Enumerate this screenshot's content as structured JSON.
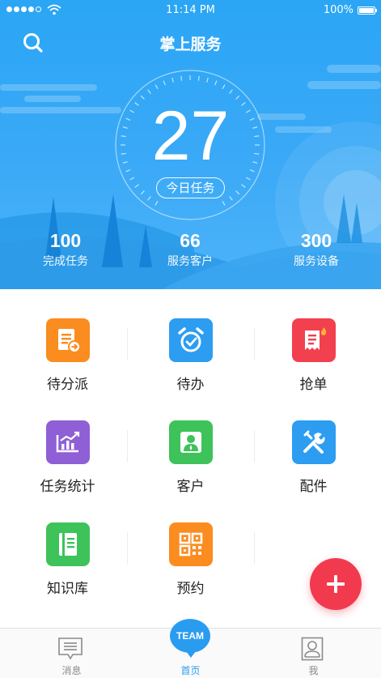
{
  "status_bar": {
    "time": "11:14 PM",
    "battery": "100%"
  },
  "header": {
    "title": "掌上服务"
  },
  "dashboard": {
    "today_count": "27",
    "today_label": "今日任务",
    "stats": [
      {
        "value": "100",
        "label": "完成任务"
      },
      {
        "value": "66",
        "label": "服务客户"
      },
      {
        "value": "300",
        "label": "服务设备"
      }
    ]
  },
  "menu": [
    {
      "label": "待分派",
      "icon": "dispatch-icon",
      "color": "#fb8c1f"
    },
    {
      "label": "待办",
      "icon": "alarm-clock-icon",
      "color": "#2c9df1"
    },
    {
      "label": "抢单",
      "icon": "grab-order-icon",
      "color": "#f2404f"
    },
    {
      "label": "任务统计",
      "icon": "stats-chart-icon",
      "color": "#8f5fd6"
    },
    {
      "label": "客户",
      "icon": "customer-icon",
      "color": "#3ec25a"
    },
    {
      "label": "配件",
      "icon": "tools-icon",
      "color": "#2c9df1"
    },
    {
      "label": "知识库",
      "icon": "knowledge-book-icon",
      "color": "#3ec25a"
    },
    {
      "label": "预约",
      "icon": "qr-code-icon",
      "color": "#fb8c1f"
    }
  ],
  "tabbar": {
    "tabs": [
      {
        "label": "消息",
        "icon": "message-icon"
      },
      {
        "label": "首页",
        "icon": "team-icon",
        "badge": "TEAM"
      },
      {
        "label": "我",
        "icon": "profile-icon"
      }
    ],
    "active_color": "#2a9cf0"
  },
  "colors": {
    "header_blue": "#2aa6f5",
    "fab_red": "#f23a4f"
  }
}
